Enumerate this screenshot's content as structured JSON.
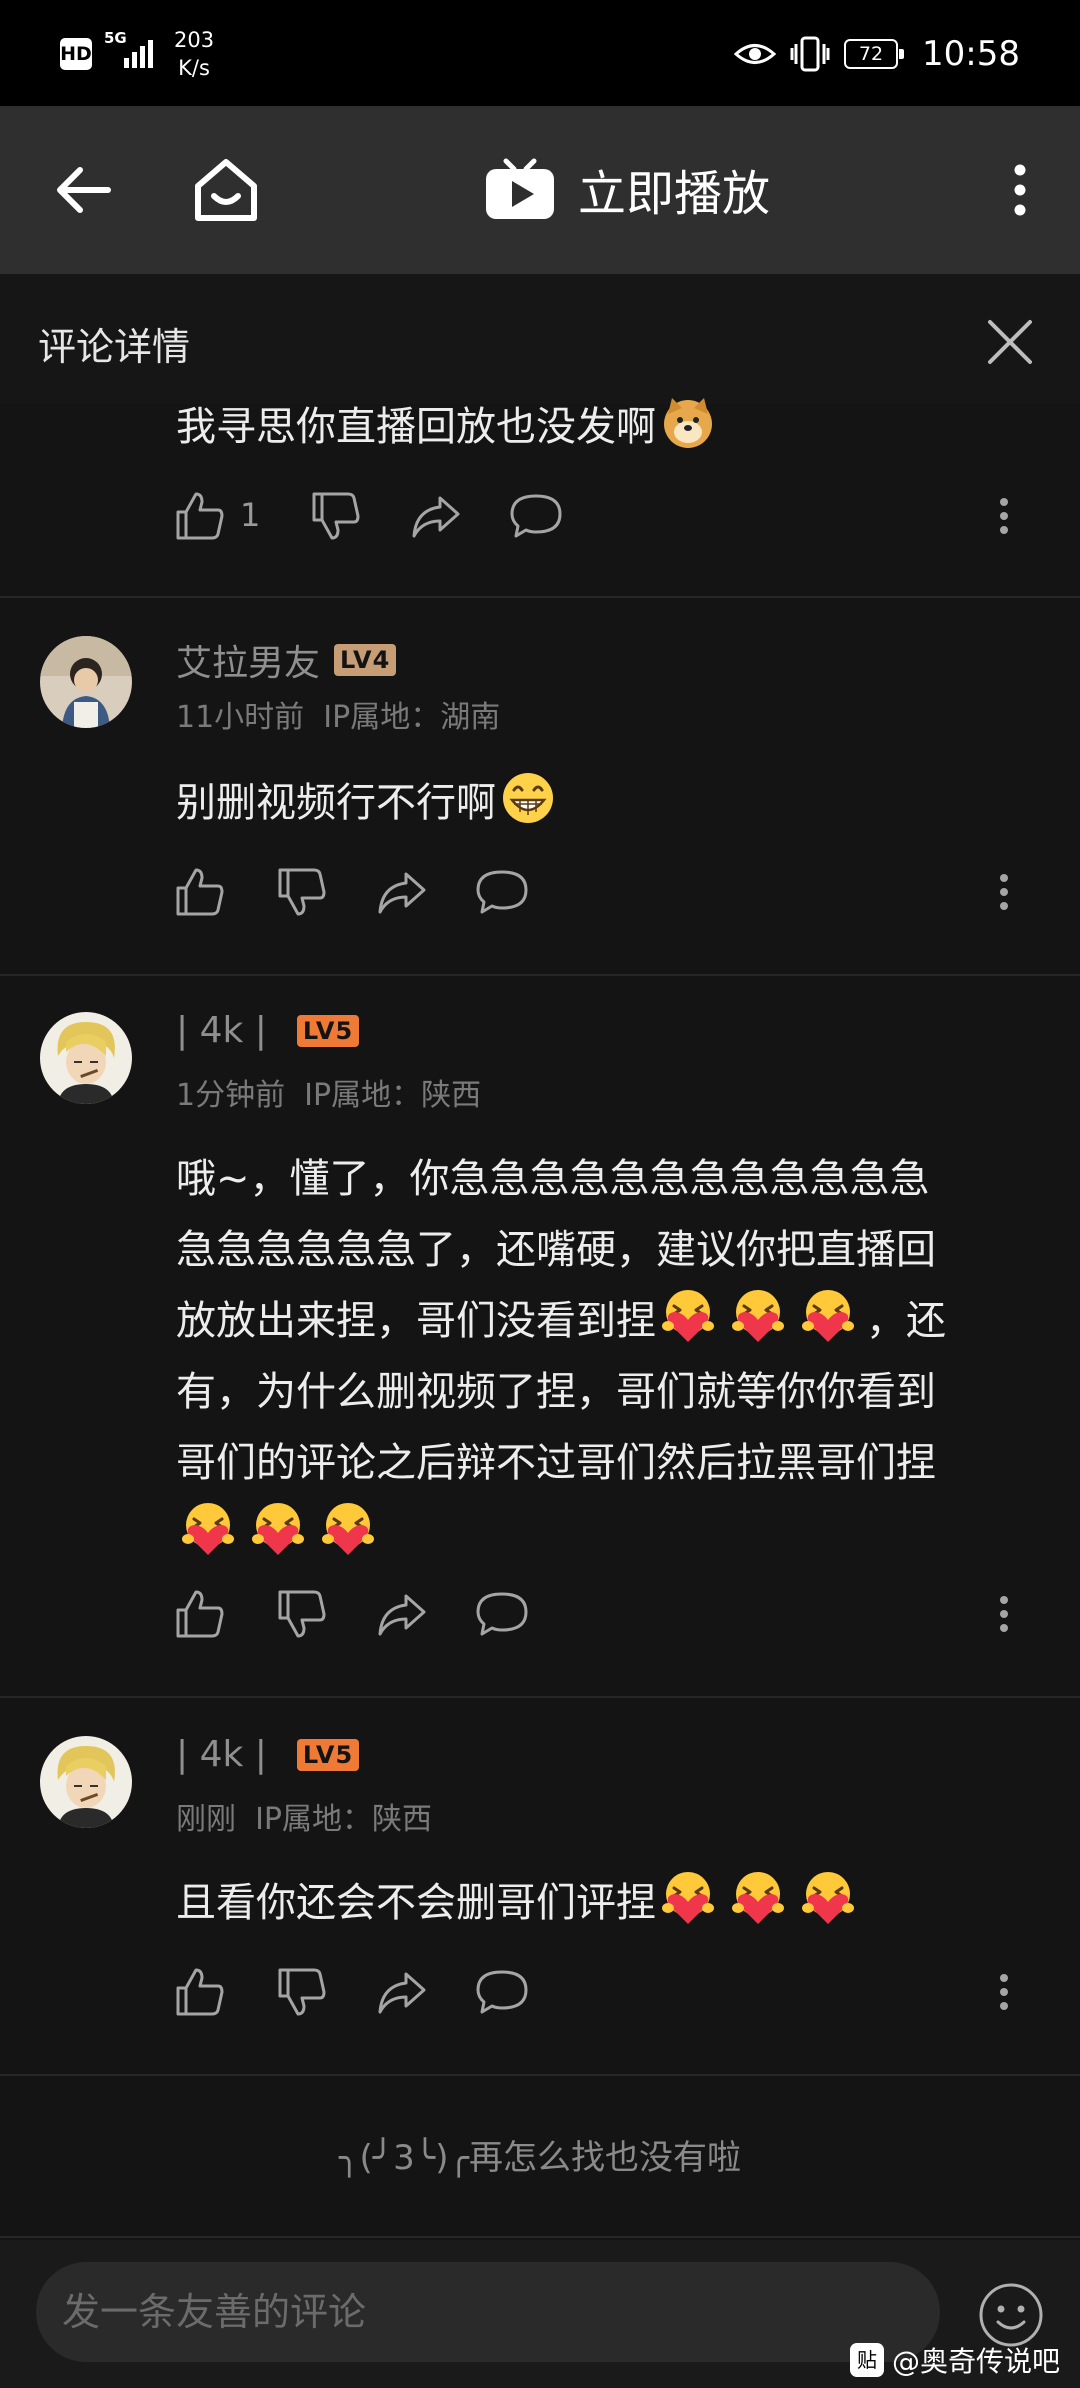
{
  "status_bar": {
    "hd": "HD",
    "network": "5G",
    "speed_value": "203",
    "speed_unit": "K/s",
    "battery": "72",
    "time": "10:58"
  },
  "nav": {
    "play_label": "立即播放"
  },
  "comment_panel": {
    "title": "评论详情"
  },
  "comments": [
    {
      "text": "我寻思你直播回放也没发啊",
      "like_count": "1"
    },
    {
      "username": "艾拉男友",
      "level": "LV4",
      "time": "11小时前",
      "ip_label": "IP属地：湖南",
      "text": "别删视频行不行啊"
    },
    {
      "username": "| 4k |",
      "level": "LV5",
      "time": "1分钟前",
      "ip_label": "IP属地：陕西",
      "text_lines": [
        "哦~，懂了，你急急急急急急急急急急急急",
        "急急急急急急了，还嘴硬，建议你把直播回",
        "放放出来捏，哥们没看到捏",
        "有，为什么删视频了捏，哥们就等你你看到",
        "哥们的评论之后辩不过哥们然后拉黑哥们捏"
      ],
      "line3_tail": "，还"
    },
    {
      "username": "| 4k |",
      "level": "LV5",
      "time": "刚刚",
      "ip_label": "IP属地：陕西",
      "text": "且看你还会不会删哥们评捏"
    }
  ],
  "end_message": "╮(╯3╰)╭再怎么找也没有啦",
  "input": {
    "placeholder": "发一条友善的评论"
  },
  "watermark": {
    "badge": "贴",
    "text": "@奥奇传说吧"
  },
  "colors": {
    "background": "#141414",
    "nav_bg": "#2f2f2f",
    "level4": "#c79d76",
    "level5": "#ee7a35"
  }
}
